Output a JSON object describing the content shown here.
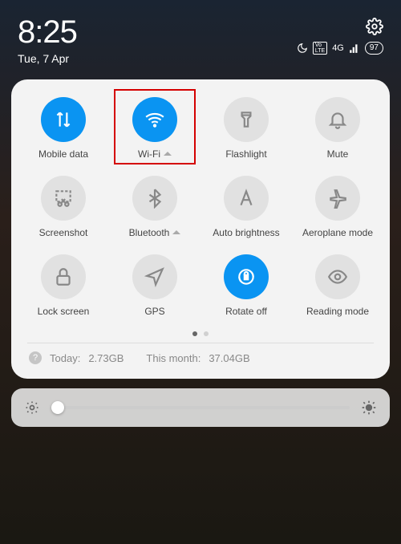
{
  "status": {
    "time": "8:25",
    "date": "Tue, 7 Apr",
    "network_badge": "4G",
    "volte_badge": "VoLTE",
    "battery": "97"
  },
  "tiles": {
    "mobile_data": "Mobile data",
    "wifi": "Wi-Fi",
    "flashlight": "Flashlight",
    "mute": "Mute",
    "screenshot": "Screenshot",
    "bluetooth": "Bluetooth",
    "auto_brightness": "Auto brightness",
    "aeroplane": "Aeroplane mode",
    "lock_screen": "Lock screen",
    "gps": "GPS",
    "rotate": "Rotate off",
    "reading": "Reading mode"
  },
  "data_usage": {
    "today_label": "Today:",
    "today_value": "2.73GB",
    "month_label": "This month:",
    "month_value": "37.04GB"
  }
}
